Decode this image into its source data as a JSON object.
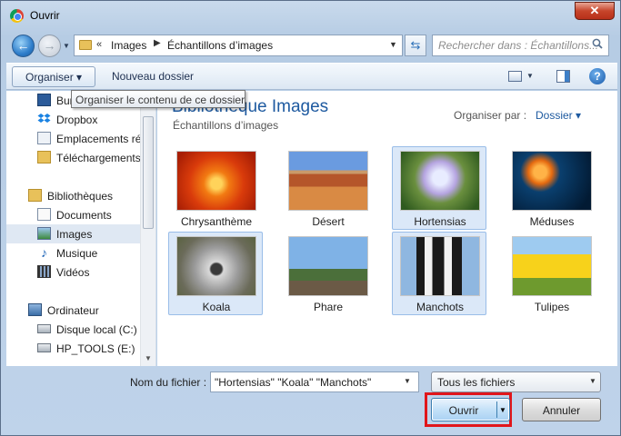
{
  "window": {
    "title": "Ouvrir",
    "close_label": "✕"
  },
  "nav": {
    "address_segments": [
      "Images",
      "Échantillons d’images"
    ],
    "address_prefix": "«",
    "search_placeholder": "Rechercher dans : Échantillons..."
  },
  "toolbar": {
    "organize_label": "Organiser ▾",
    "new_folder_label": "Nouveau dossier",
    "help_label": "?"
  },
  "tooltip": "Organiser le contenu de ce dossier.",
  "sidebar": {
    "items": [
      {
        "label": "Bureau"
      },
      {
        "label": "Dropbox"
      },
      {
        "label": "Emplacements récents"
      },
      {
        "label": "Téléchargements"
      },
      {
        "label": "Bibliothèques"
      },
      {
        "label": "Documents"
      },
      {
        "label": "Images"
      },
      {
        "label": "Musique"
      },
      {
        "label": "Vidéos"
      },
      {
        "label": "Ordinateur"
      },
      {
        "label": "Disque local (C:)"
      },
      {
        "label": "HP_TOOLS (E:)"
      }
    ]
  },
  "content": {
    "title": "Bibliothèque Images",
    "subtitle": "Échantillons d’images",
    "sort_label": "Organiser par :",
    "sort_value": "Dossier ▾",
    "thumbs": [
      {
        "label": "Chrysanthème",
        "selected": false
      },
      {
        "label": "Désert",
        "selected": false
      },
      {
        "label": "Hortensias",
        "selected": true
      },
      {
        "label": "Méduses",
        "selected": false
      },
      {
        "label": "Koala",
        "selected": true
      },
      {
        "label": "Phare",
        "selected": false
      },
      {
        "label": "Manchots",
        "selected": true
      },
      {
        "label": "Tulipes",
        "selected": false
      }
    ]
  },
  "bottom": {
    "filename_label": "Nom du fichier :",
    "filename_value": "\"Hortensias\" \"Koala\" \"Manchots\"",
    "filetype_value": "Tous les fichiers",
    "open_label": "Ouvrir",
    "cancel_label": "Annuler"
  },
  "colors": {
    "highlight": "#e1161b",
    "accent": "#1e5aa0",
    "selection": "#dbe8f8"
  }
}
